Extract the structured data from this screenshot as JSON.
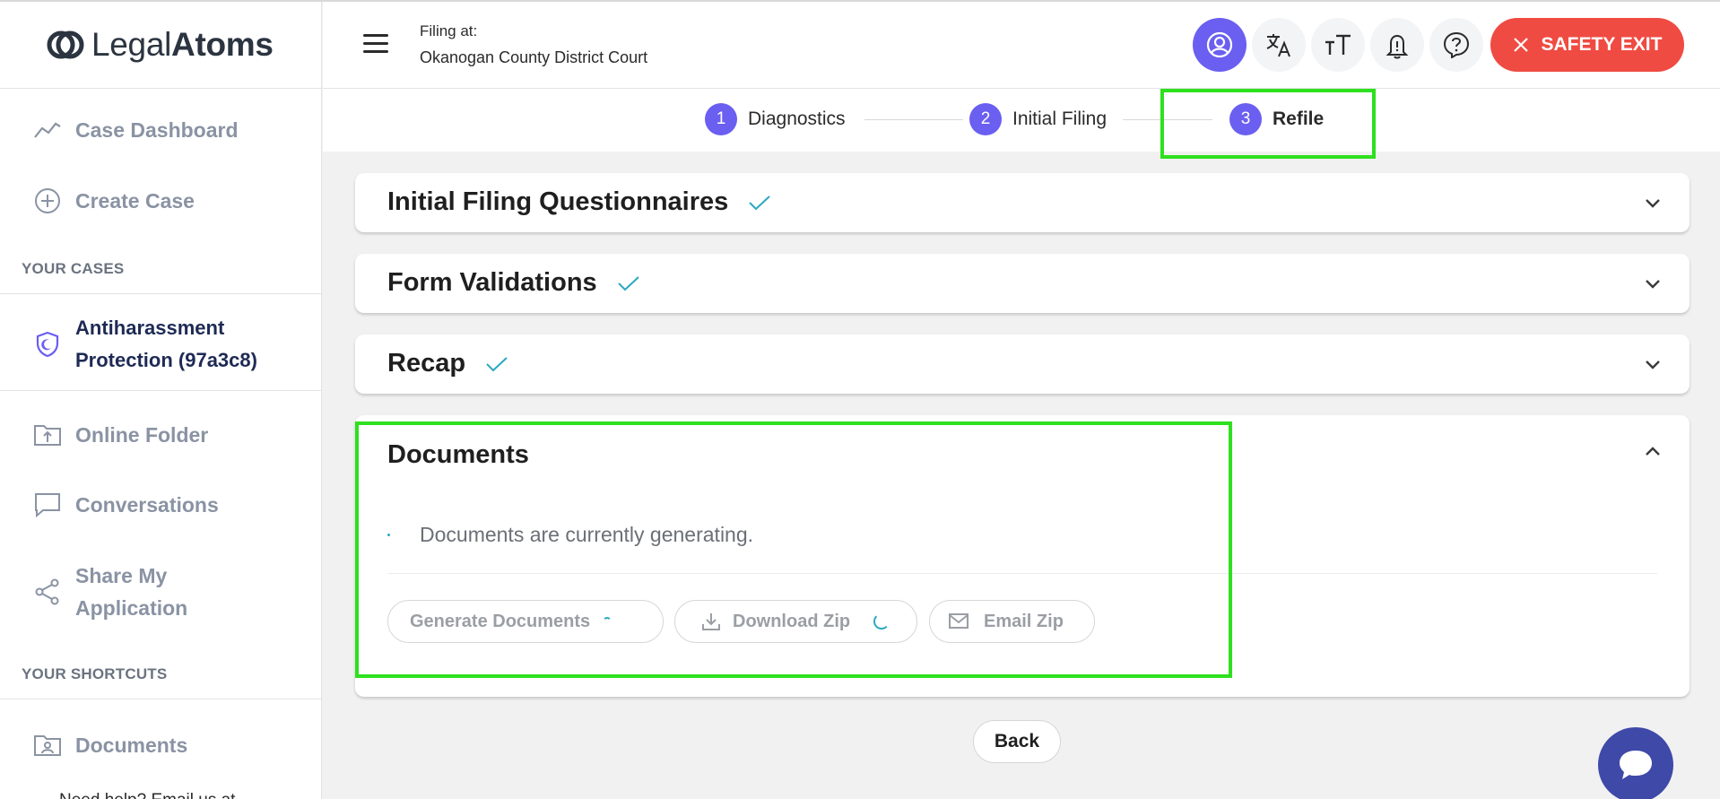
{
  "brand": {
    "name_light": "Legal",
    "name_bold": "Atoms"
  },
  "sidebar": {
    "items": [
      {
        "label": "Case Dashboard",
        "icon": "trend-line-icon"
      },
      {
        "label": "Create Case",
        "icon": "plus-circle-icon"
      }
    ],
    "your_cases_label": "YOUR CASES",
    "case": {
      "line1": "Antiharassment",
      "line2": "Protection (97a3c8)",
      "icon": "shield-icon"
    },
    "more_items": [
      {
        "label": "Online Folder",
        "icon": "folder-upload-icon"
      },
      {
        "label": "Conversations",
        "icon": "chat-bubble-icon"
      },
      {
        "label_line1": "Share My",
        "label_line2": "Application",
        "icon": "share-icon"
      }
    ],
    "your_shortcuts_label": "YOUR SHORTCUTS",
    "shortcuts": [
      {
        "label": "Documents",
        "icon": "folder-user-icon"
      }
    ],
    "cut_off_text": "Need help? Email us at"
  },
  "header": {
    "filing_label": "Filing at:",
    "court": "Okanogan County District Court",
    "safety_exit": "SAFETY EXIT"
  },
  "stepper": [
    {
      "num": "1",
      "label": "Diagnostics"
    },
    {
      "num": "2",
      "label": "Initial Filing"
    },
    {
      "num": "3",
      "label": "Refile"
    }
  ],
  "sections": [
    {
      "title": "Initial Filing Questionnaires",
      "complete": true
    },
    {
      "title": "Form Validations",
      "complete": true
    },
    {
      "title": "Recap",
      "complete": true
    }
  ],
  "documents": {
    "title": "Documents",
    "status": "Documents are currently generating.",
    "buttons": {
      "generate": "Generate Documents",
      "download": "Download Zip",
      "email": "Email Zip"
    }
  },
  "back_label": "Back",
  "colors": {
    "accent": "#6a5ff0",
    "safety": "#ef4b42",
    "check": "#2aa8c0",
    "highlight": "#2ee01f",
    "case_text": "#1e2a55"
  }
}
